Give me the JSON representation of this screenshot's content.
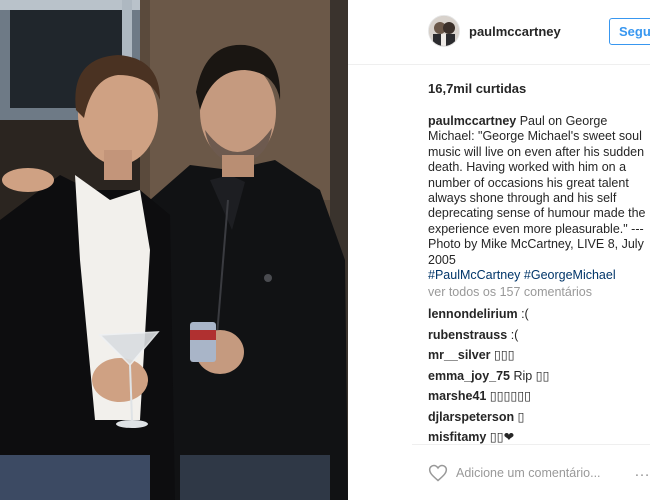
{
  "post": {
    "username": "paulmccartney",
    "follow_label": "Segu",
    "likes": "16,7mil curtidas",
    "caption": {
      "username": "paulmccartney",
      "text": "Paul on George Michael: \"George Michael's sweet soul music will live on even after his sudden death. Having worked with him on a number of occasions his great talent always shone through and his self deprecating sense of humour made the experience even more pleasurable.\" ---",
      "photo_credit": "Photo by Mike McCartney, LIVE 8, July 2005",
      "hashtags": [
        "#PaulMcCartney",
        "#GeorgeMichael"
      ]
    },
    "view_all_comments": "ver todos os 157 comentários",
    "comments": [
      {
        "user": "lennondelirium",
        "text": ":("
      },
      {
        "user": "rubenstrauss",
        "text": ":("
      },
      {
        "user": "mr__silver",
        "text": "▯▯▯"
      },
      {
        "user": "emma_joy_75",
        "text": "Rip ▯▯"
      },
      {
        "user": "marshe41",
        "text": "▯▯▯▯▯▯"
      },
      {
        "user": "djlarspeterson",
        "text": "▯"
      },
      {
        "user": "misfitamy",
        "text": "▯▯❤"
      }
    ],
    "add_comment_placeholder": "Adicione um comentário...",
    "more_options": "…"
  },
  "icons": {
    "like": "heart-icon",
    "options": "more-options-icon"
  },
  "colors": {
    "accent": "#3897f0",
    "hashtag": "#003569",
    "muted": "#999999",
    "text": "#262626"
  }
}
